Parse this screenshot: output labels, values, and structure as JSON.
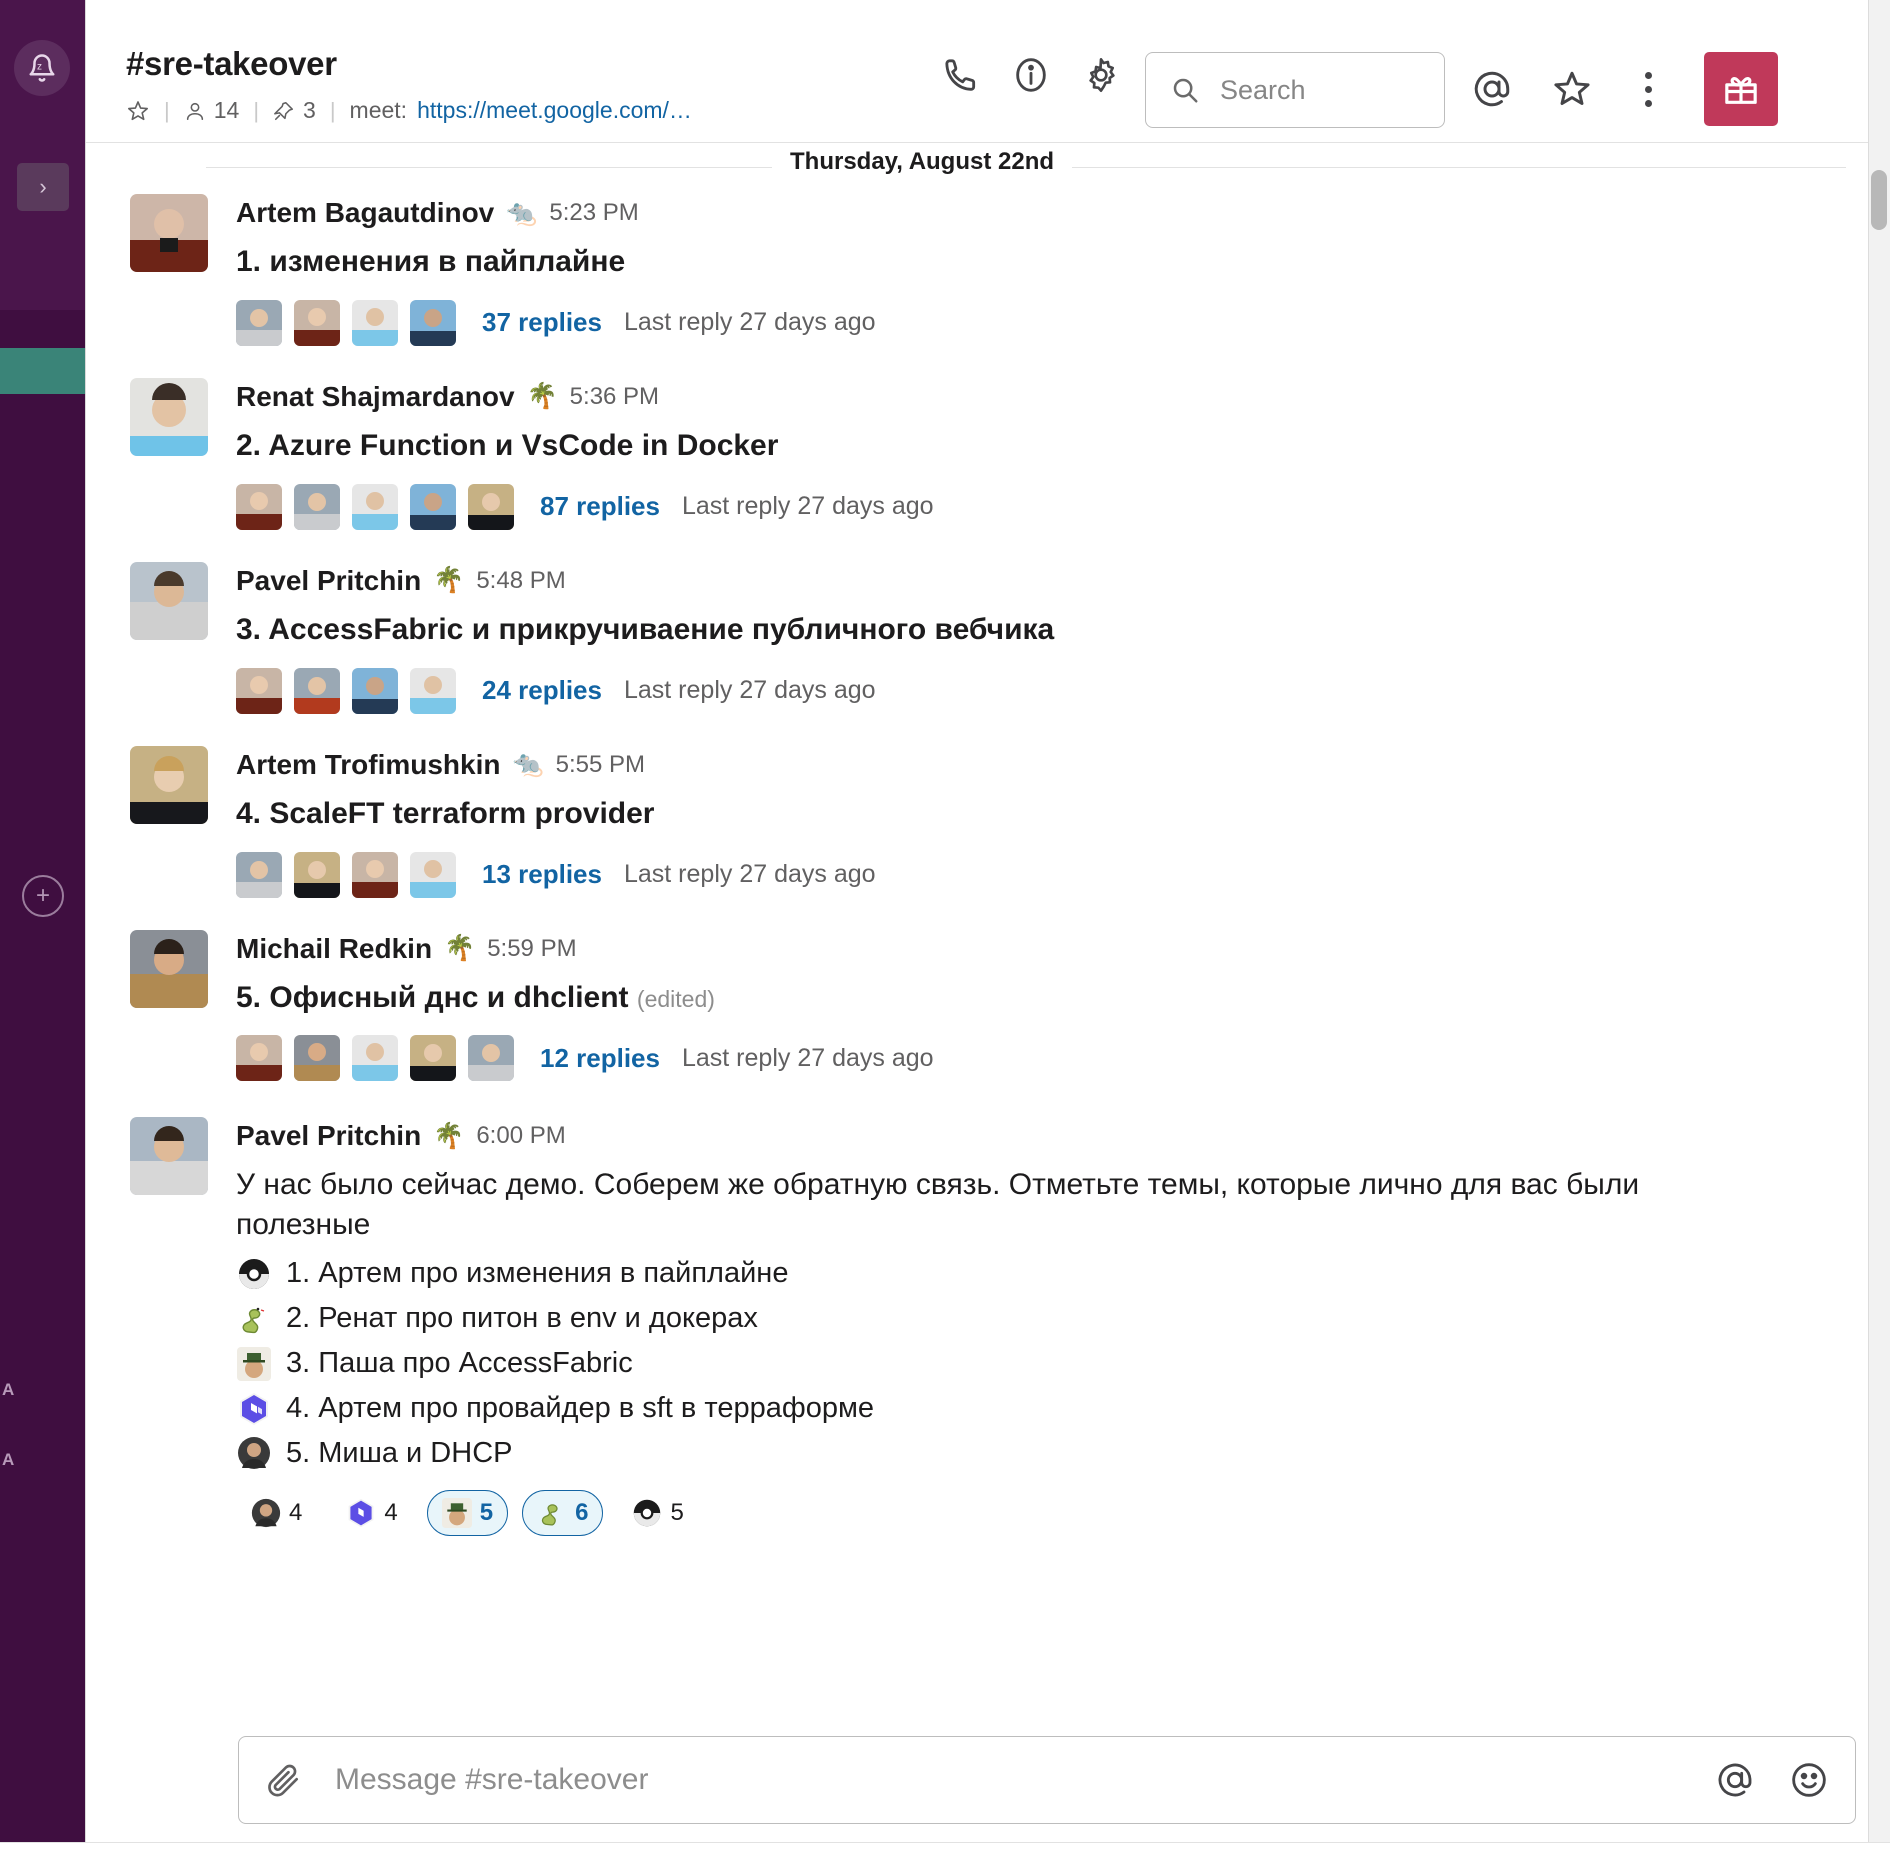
{
  "workspace": {
    "dnd_icon": "snooze-bell-icon",
    "expand_icon": "chevron-right-icon",
    "add_icon": "plus-circle-icon",
    "rail_letters": [
      "A",
      "A"
    ]
  },
  "header": {
    "channel_name": "#sre-takeover",
    "star_icon": "star-outline-icon",
    "members_icon": "person-icon",
    "members_count": "14",
    "pin_icon": "pin-icon",
    "pins_count": "3",
    "topic_prefix": "meet:",
    "topic_link": "https://meet.google.com/…",
    "icons": [
      {
        "name": "call-icon",
        "label": "Call"
      },
      {
        "name": "info-icon",
        "label": "Channel details"
      },
      {
        "name": "gear-icon",
        "label": "Settings"
      }
    ],
    "right_icons": [
      {
        "name": "mentions-icon",
        "label": "Mentions & reactions"
      },
      {
        "name": "starred-icon",
        "label": "Starred items"
      },
      {
        "name": "kebab-menu-icon",
        "label": "More"
      }
    ],
    "gift_button": {
      "name": "gift-icon",
      "label": "Gift"
    }
  },
  "search": {
    "placeholder": "Search",
    "icon": "search-icon"
  },
  "date_divider": "Thursday, August 22nd",
  "messages": [
    {
      "author": "Artem Bagautdinov",
      "badge": "🐀",
      "time": "5:23 PM",
      "text": "1. изменения в пайплайне",
      "bold": true,
      "edited": "",
      "reply_avatars": 4,
      "reply_count": "37 replies",
      "last_reply": "Last reply 27 days ago"
    },
    {
      "author": "Renat Shajmardanov",
      "badge": "🌴",
      "time": "5:36 PM",
      "text": "2. Azure Function и VsCode in Docker",
      "bold": true,
      "edited": "",
      "reply_avatars": 5,
      "reply_count": "87 replies",
      "last_reply": "Last reply 27 days ago"
    },
    {
      "author": "Pavel Pritchin",
      "badge": "🌴",
      "time": "5:48 PM",
      "text": "3. AccessFabric и прикручиваение публичного вебчика",
      "bold": true,
      "edited": "",
      "reply_avatars": 4,
      "reply_count": "24 replies",
      "last_reply": "Last reply 27 days ago"
    },
    {
      "author": "Artem Trofimushkin",
      "badge": "🐀",
      "time": "5:55 PM",
      "text": "4. ScaleFT terraform provider",
      "bold": true,
      "edited": "",
      "reply_avatars": 4,
      "reply_count": "13 replies",
      "last_reply": "Last reply 27 days ago"
    },
    {
      "author": "Michail Redkin",
      "badge": "🌴",
      "time": "5:59 PM",
      "text": "5. Офисный днс и dhclient",
      "bold": true,
      "edited": "(edited)",
      "reply_avatars": 5,
      "reply_count": "12 replies",
      "last_reply": "Last reply 27 days ago"
    }
  ],
  "last_message": {
    "author": "Pavel Pritchin",
    "badge": "🌴",
    "time": "6:00 PM",
    "text": "У нас было сейчас демо. Соберем же обратную связь. Отметьте темы, которые лично для вас были полезные",
    "list": [
      {
        "emoji_name": "pokeball-icon",
        "text": "1. Артем про изменения в пайплайне"
      },
      {
        "emoji_name": "snake-icon",
        "text": "2. Ренат про питон в env и докерах"
      },
      {
        "emoji_name": "hat-face-icon",
        "text": "3. Паша про AccessFabric"
      },
      {
        "emoji_name": "terraform-icon",
        "text": "4. Артем про провайдер в sft в террaформе"
      },
      {
        "emoji_name": "person-photo-icon",
        "text": "5. Миша и DHCP"
      }
    ],
    "reactions": [
      {
        "emoji_name": "person-photo-icon",
        "count": "4",
        "selected": false
      },
      {
        "emoji_name": "terraform-icon",
        "count": "4",
        "selected": false
      },
      {
        "emoji_name": "hat-face-icon",
        "count": "5",
        "selected": true
      },
      {
        "emoji_name": "snake-icon",
        "count": "6",
        "selected": true
      },
      {
        "emoji_name": "pokeball-icon",
        "count": "5",
        "selected": false
      }
    ]
  },
  "composer": {
    "placeholder": "Message #sre-takeover",
    "attach_icon": "paperclip-icon",
    "mention_icon": "mention-icon",
    "emoji_icon": "smiley-icon"
  },
  "colors": {
    "rail": "#3f0e40",
    "link": "#1264a3",
    "gift": "#c0395a",
    "active_rail": "#3a8478"
  }
}
